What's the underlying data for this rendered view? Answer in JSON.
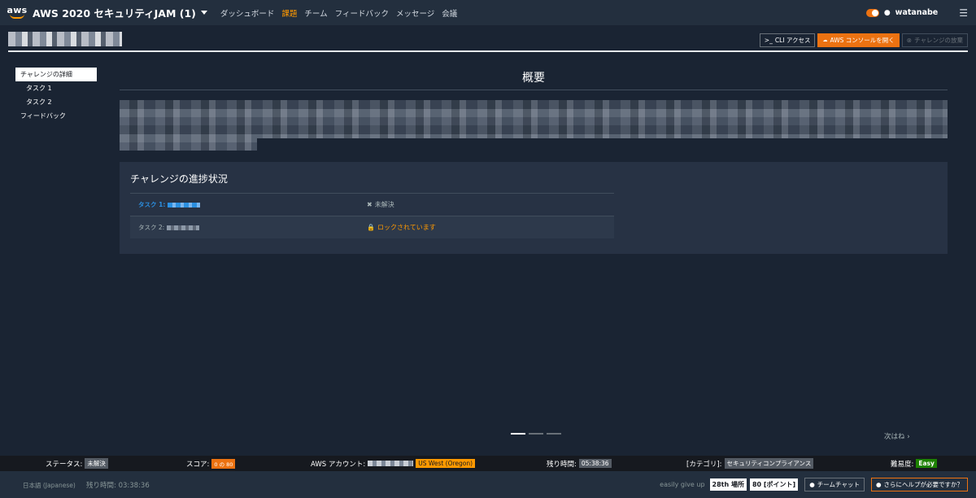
{
  "navbar": {
    "logo": "aws",
    "event_title": "AWS 2020 セキュリティJAM (1)",
    "links": [
      {
        "label": "ダッシュボード",
        "active": false
      },
      {
        "label": "課題",
        "active": true
      },
      {
        "label": "チーム",
        "active": false
      },
      {
        "label": "フィードバック",
        "active": false
      },
      {
        "label": "メッセージ",
        "active": false
      },
      {
        "label": "会議",
        "active": false
      }
    ],
    "username": "watanabe"
  },
  "header": {
    "cli_label": "CLI アクセス",
    "console_label": "AWS コンソールを開く",
    "giveup_label": "チャレンジの放棄"
  },
  "left_nav": {
    "items": [
      {
        "label": "チャレンジの詳細"
      },
      {
        "label": "タスク 1"
      },
      {
        "label": "タスク 2"
      },
      {
        "label": "フィードバック"
      }
    ]
  },
  "main": {
    "overview_title": "概要",
    "progress": {
      "title": "チャレンジの進捗状況",
      "rows": [
        {
          "task": "タスク 1:",
          "status": "未解決"
        },
        {
          "task": "タスク 2:",
          "status": "ロックされています"
        }
      ]
    },
    "next_label": "次はね"
  },
  "statusbar": {
    "status_label": "ステータス:",
    "status_value": "未解決",
    "score_label": "スコア:",
    "score_value": "0 の 80",
    "account_label": "AWS アカウント:",
    "region": "US West (Oregon)",
    "remaining_label": "残り時間:",
    "remaining_value": "05:38:36",
    "category_label": "[カテゴリ]:",
    "category_value": "セキュリティコンプライアンス",
    "difficulty_label": "難易度:",
    "difficulty_value": "Easy"
  },
  "footer": {
    "language": "日本語 (Japanese)",
    "remaining": "残り時間: 03:38:36",
    "giveup_text": "easily give up",
    "rank": "28th 場所",
    "points": "80 [ポイント]",
    "team_chat": "チームチャット",
    "help": "さらにヘルプが必要ですか？"
  },
  "colors": {
    "accent": "#ec7211",
    "nav_bg": "#232f3e",
    "page_bg": "#1a2433",
    "success": "#1d8102",
    "region": "#ff9900"
  }
}
